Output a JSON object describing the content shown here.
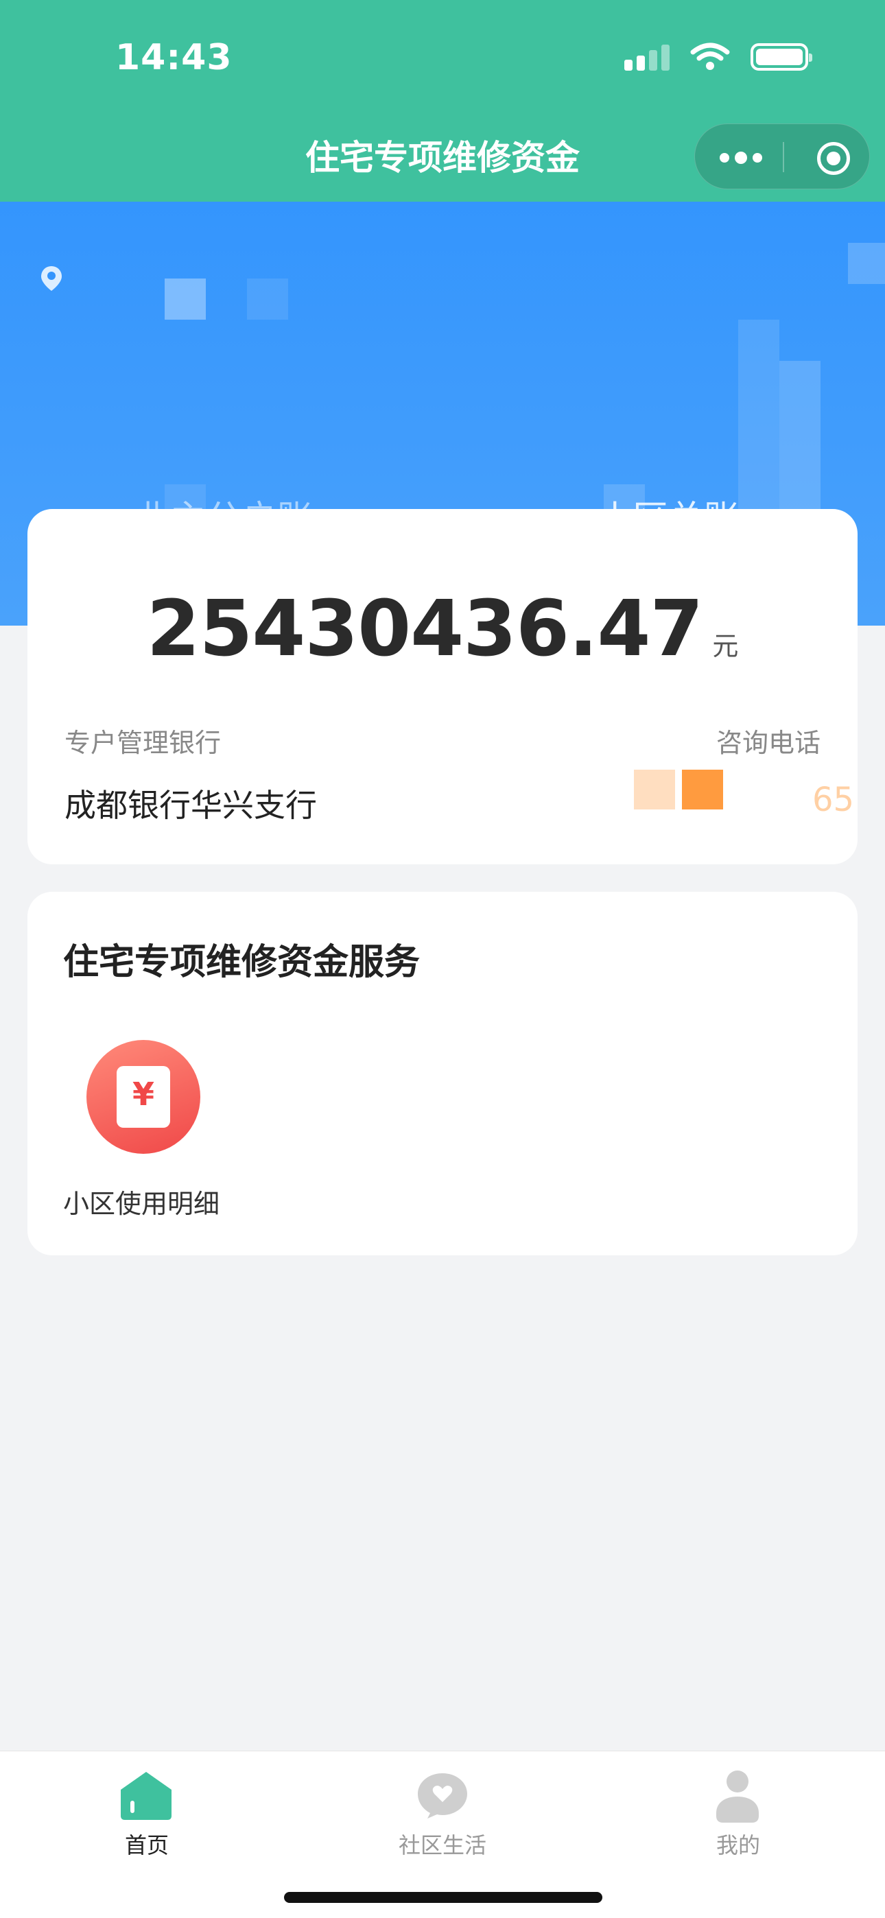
{
  "status_bar": {
    "time": "14:43"
  },
  "nav": {
    "title": "住宅专项维修资金"
  },
  "hero": {
    "tabs": [
      "业主分户账",
      "小区总账"
    ],
    "colors": {
      "top_bar": "#3fc19e",
      "hero": "#3495fd"
    }
  },
  "summary": {
    "amount": "25430436.47",
    "unit": "元",
    "bank_label": "专户管理银行",
    "bank_value": "成都银行华兴支行",
    "phone_label": "咨询电话",
    "phone_value": "65"
  },
  "services": {
    "title": "住宅专项维修资金服务",
    "items": [
      {
        "label": "小区使用明细",
        "icon": "receipt-yuan-icon",
        "glyph": "¥"
      }
    ]
  },
  "tabbar": {
    "items": [
      {
        "label": "首页",
        "icon": "home-icon",
        "active": true
      },
      {
        "label": "社区生活",
        "icon": "heart-chat-icon",
        "active": false
      },
      {
        "label": "我的",
        "icon": "user-icon",
        "active": false
      }
    ],
    "active_color": "#3fc19e"
  }
}
